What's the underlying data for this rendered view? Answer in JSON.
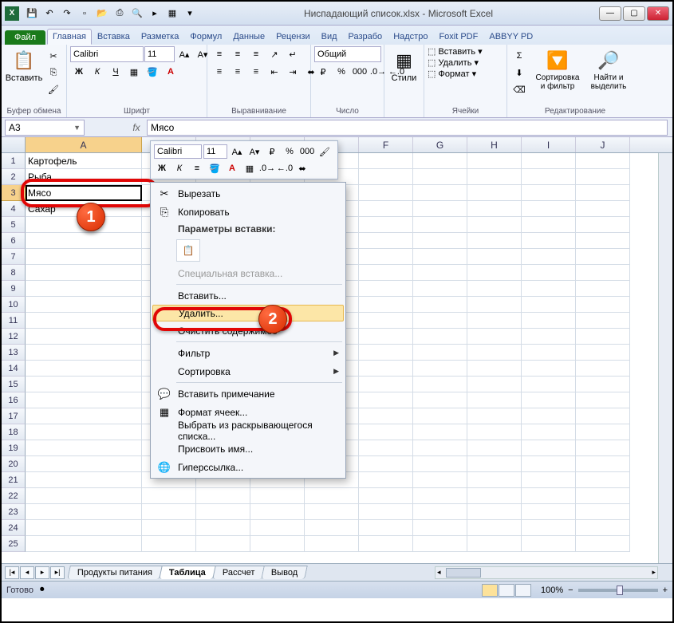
{
  "title": "Ниспадающий список.xlsx - Microsoft Excel",
  "qat": {
    "save": "💾",
    "undo": "↶",
    "redo": "↷",
    "new": "▫",
    "open": "📂",
    "quick": "⎙",
    "preview": "🔍",
    "run": "▸",
    "macro": "▦"
  },
  "file_tab": "Файл",
  "tabs": [
    "Главная",
    "Вставка",
    "Разметка",
    "Формул",
    "Данные",
    "Рецензи",
    "Вид",
    "Разрабо",
    "Надстро",
    "Foxit PDF",
    "ABBYY PD"
  ],
  "active_tab": 0,
  "ribbon": {
    "clipboard": {
      "paste": "Вставить",
      "label": "Буфер обмена"
    },
    "font": {
      "name": "Calibri",
      "size": "11",
      "label": "Шрифт"
    },
    "align": {
      "label": "Выравнивание"
    },
    "number": {
      "format": "Общий",
      "label": "Число"
    },
    "styles": {
      "styles": "Стили",
      "label": ""
    },
    "cells": {
      "insert": "Вставить",
      "delete": "Удалить",
      "format": "Формат",
      "label": "Ячейки"
    },
    "editing": {
      "sort": "Сортировка и фильтр",
      "find": "Найти и выделить",
      "label": "Редактирование"
    }
  },
  "namebox": "A3",
  "formula": "Мясо",
  "columns": [
    "A",
    "B",
    "C",
    "D",
    "E",
    "F",
    "G",
    "H",
    "I",
    "J"
  ],
  "selected_col": 0,
  "selected_row": 3,
  "rows": [
    {
      "n": 1,
      "a": "Картофель"
    },
    {
      "n": 2,
      "a": "Рыба"
    },
    {
      "n": 3,
      "a": "Мясо"
    },
    {
      "n": 4,
      "a": "Сахар"
    },
    {
      "n": 5,
      "a": ""
    },
    {
      "n": 6,
      "a": ""
    },
    {
      "n": 7,
      "a": ""
    },
    {
      "n": 8,
      "a": ""
    },
    {
      "n": 9,
      "a": ""
    },
    {
      "n": 10,
      "a": ""
    },
    {
      "n": 11,
      "a": ""
    },
    {
      "n": 12,
      "a": ""
    },
    {
      "n": 13,
      "a": ""
    },
    {
      "n": 14,
      "a": ""
    },
    {
      "n": 15,
      "a": ""
    },
    {
      "n": 16,
      "a": ""
    },
    {
      "n": 17,
      "a": ""
    },
    {
      "n": 18,
      "a": ""
    },
    {
      "n": 19,
      "a": ""
    },
    {
      "n": 20,
      "a": ""
    },
    {
      "n": 21,
      "a": ""
    },
    {
      "n": 22,
      "a": ""
    },
    {
      "n": 23,
      "a": ""
    },
    {
      "n": 24,
      "a": ""
    },
    {
      "n": 25,
      "a": ""
    }
  ],
  "mini": {
    "font": "Calibri",
    "size": "11"
  },
  "context_menu": {
    "cut": "Вырезать",
    "copy": "Копировать",
    "paste_opts": "Параметры вставки:",
    "paste_special": "Специальная вставка...",
    "insert": "Вставить...",
    "delete": "Удалить...",
    "clear": "Очистить содержимое",
    "filter": "Фильтр",
    "sort": "Сортировка",
    "comment": "Вставить примечание",
    "format_cells": "Формат ячеек...",
    "pick_list": "Выбрать из раскрывающегося списка...",
    "define_name": "Присвоить имя...",
    "hyperlink": "Гиперссылка..."
  },
  "callout1": "1",
  "callout2": "2",
  "sheets": [
    "Продукты питания",
    "Таблица",
    "Рассчет",
    "Вывод"
  ],
  "active_sheet": 1,
  "status": "Готово",
  "zoom": "100%"
}
